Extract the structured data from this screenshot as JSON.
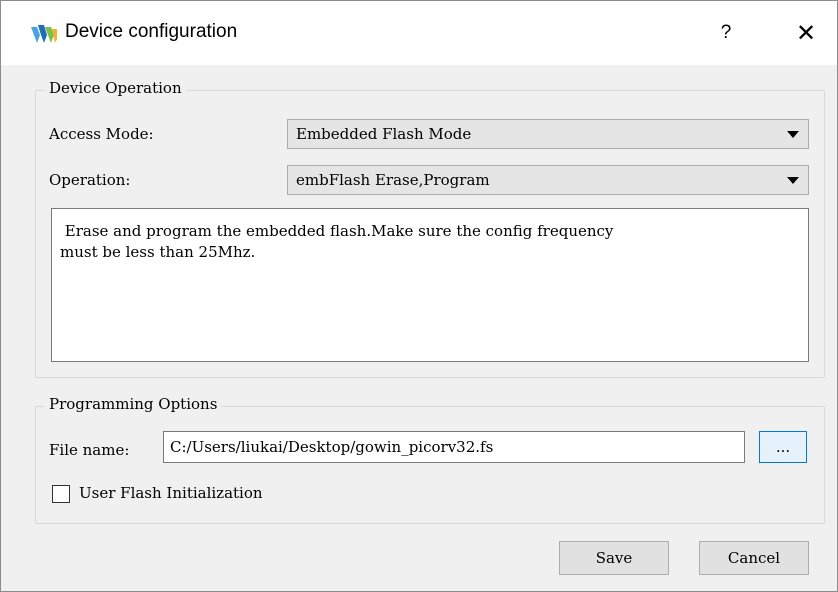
{
  "window": {
    "title": "Device configuration",
    "help_label": "?",
    "close_label": "✕",
    "icon": "gowin-logo-icon"
  },
  "device_operation": {
    "group_title": "Device Operation",
    "access_mode_label": "Access Mode:",
    "access_mode_value": "Embedded Flash Mode",
    "operation_label": "Operation:",
    "operation_value": "embFlash Erase,Program",
    "description": " Erase and program the embedded flash.Make sure the config frequency\nmust be less than 25Mhz."
  },
  "programming_options": {
    "group_title": "Programming Options",
    "file_name_label": "File name:",
    "file_name_value": "C:/Users/liukai/Desktop/gowin_picorv32.fs",
    "browse_label": "...",
    "user_flash_init_label": "User Flash Initialization",
    "user_flash_init_checked": false
  },
  "buttons": {
    "save_label": "Save",
    "cancel_label": "Cancel"
  },
  "colors": {
    "titlebar": "#ffffff",
    "dialog_bg": "#f0f0f0",
    "combo_bg": "#e5e5e5",
    "browse_border": "#0078d7"
  }
}
